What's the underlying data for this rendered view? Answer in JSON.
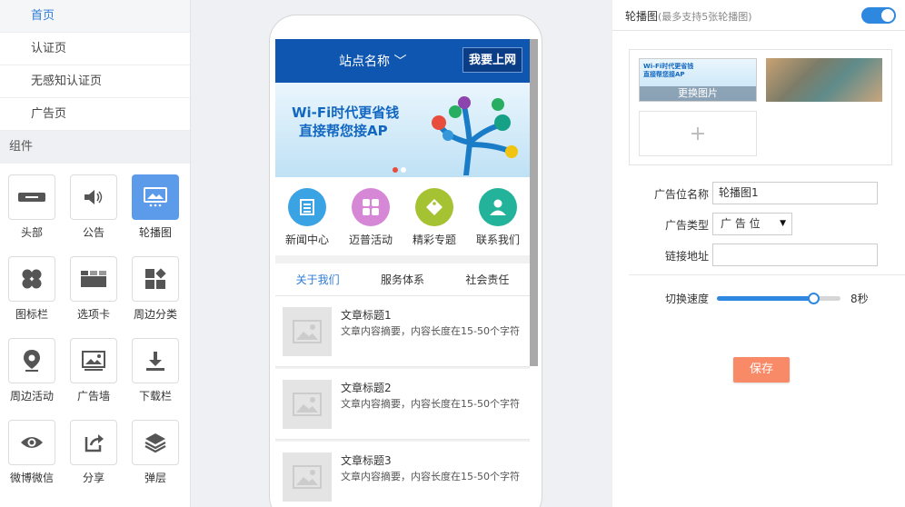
{
  "left_panel": {
    "pages": [
      {
        "label": "首页",
        "active": true
      },
      {
        "label": "认证页",
        "active": false
      },
      {
        "label": "无感知认证页",
        "active": false
      },
      {
        "label": "广告页",
        "active": false
      }
    ],
    "components_title": "组件",
    "components": [
      {
        "label": "头部",
        "icon": "header-icon"
      },
      {
        "label": "公告",
        "icon": "speaker-icon"
      },
      {
        "label": "轮播图",
        "icon": "carousel-icon",
        "selected": true
      },
      {
        "label": "图标栏",
        "icon": "icon-bar-icon"
      },
      {
        "label": "选项卡",
        "icon": "tabs-icon"
      },
      {
        "label": "周边分类",
        "icon": "category-icon"
      },
      {
        "label": "周边活动",
        "icon": "location-pin-icon"
      },
      {
        "label": "广告墙",
        "icon": "image-icon"
      },
      {
        "label": "下载栏",
        "icon": "download-icon"
      },
      {
        "label": "微博微信",
        "icon": "eye-icon"
      },
      {
        "label": "分享",
        "icon": "share-icon"
      },
      {
        "label": "弹层",
        "icon": "layers-icon"
      }
    ]
  },
  "phone": {
    "site_name": "站点名称",
    "online_button": "我要上网",
    "banner": {
      "line1": "Wi-Fi时代更省钱",
      "line2": "直接帮您接AP"
    },
    "icons": [
      {
        "label": "新闻中心",
        "color": "#3aa3e3"
      },
      {
        "label": "迈普活动",
        "color": "#d687d6"
      },
      {
        "label": "精彩专题",
        "color": "#a5c233"
      },
      {
        "label": "联系我们",
        "color": "#22b39a"
      }
    ],
    "tabs": [
      "关于我们",
      "服务体系",
      "社会责任"
    ],
    "articles": [
      {
        "title": "文章标题1",
        "summary": "文章内容摘要，内容长度在15-50个字符"
      },
      {
        "title": "文章标题2",
        "summary": "文章内容摘要，内容长度在15-50个字符"
      },
      {
        "title": "文章标题3",
        "summary": "文章内容摘要，内容长度在15-50个字符"
      }
    ]
  },
  "right_panel": {
    "title": "轮播图",
    "hint": "(最多支持5张轮播图)",
    "toggle_on": true,
    "replace_image_label": "更换图片",
    "mini_banner_line1": "Wi-Fi时代更省钱",
    "mini_banner_line2": "直接帮您接AP",
    "form": {
      "name_label": "广告位名称",
      "name_value": "轮播图1",
      "type_label": "广告类型",
      "type_value": "广 告 位",
      "link_label": "链接地址",
      "link_value": "",
      "speed_label": "切换速度",
      "speed_value": "8秒",
      "speed_fraction": 0.78
    },
    "save_label": "保存"
  },
  "colors": {
    "accent": "#2e88e0",
    "header_blue": "#0f56b1",
    "save": "#f98a67"
  }
}
